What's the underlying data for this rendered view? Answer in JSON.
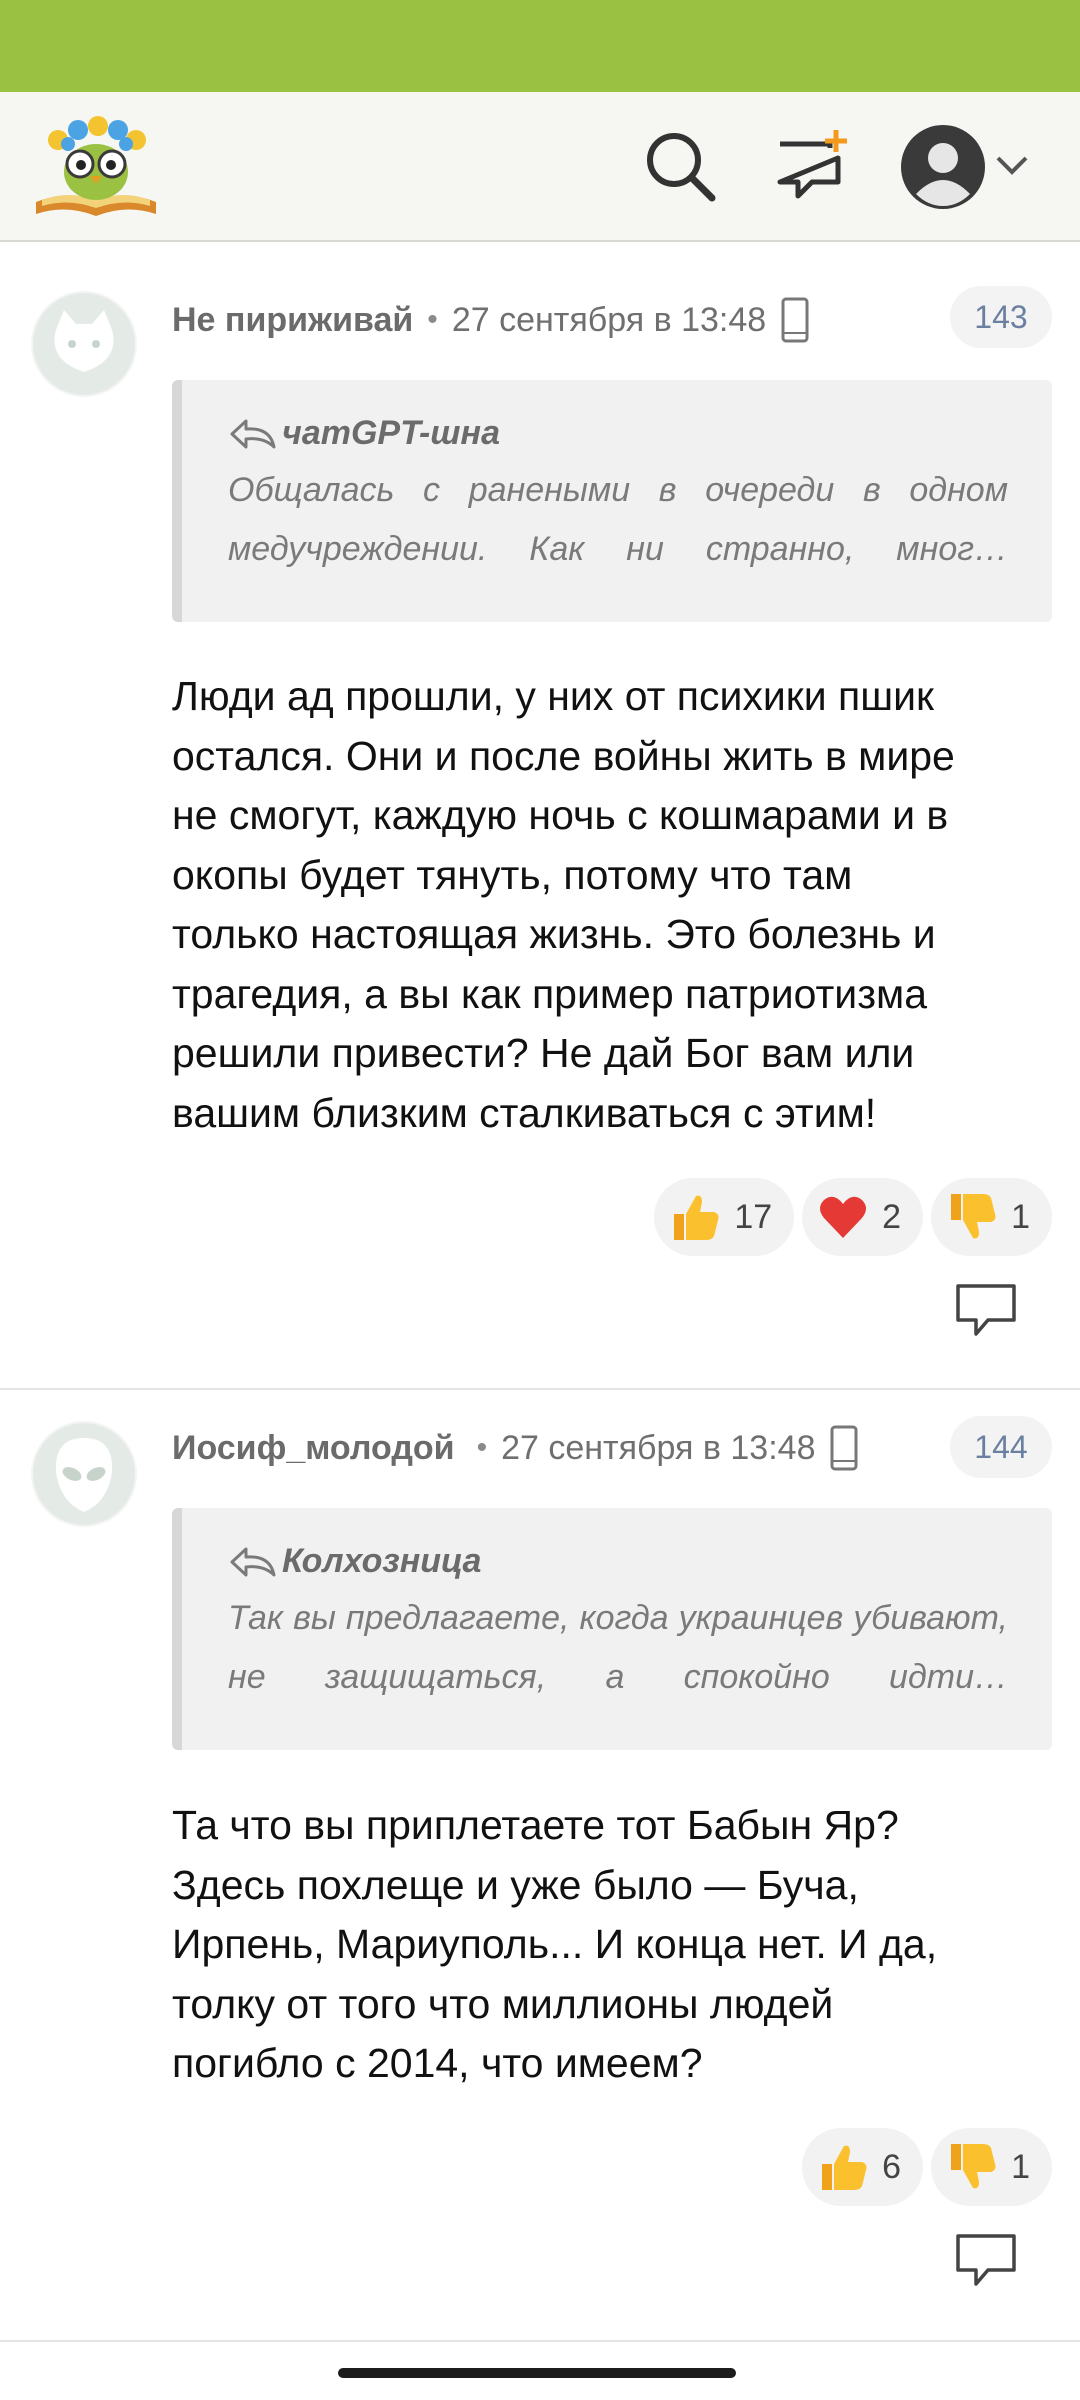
{
  "header": {
    "logo": "owl-logo",
    "icons": [
      "search-icon",
      "new-message-icon",
      "user-avatar-icon",
      "chevron-down-icon"
    ]
  },
  "comments": [
    {
      "author": "Не пириживай",
      "time": "27 сентября в 13:48",
      "number": "143",
      "avatar": "cat-avatar-icon",
      "quote_author": "чатGPT-шна",
      "quote_text": "Общалась с ранеными в очереди в одном медучреждении. Как ни странно, мног…",
      "body": [
        "Люди ад прошли, у них от психики пшик",
        "остался. Они и после войны жить в мире",
        "не смогут, каждую ночь с кошмарами и в",
        "окопы будет тянуть, потому что там",
        "только настоящая жизнь. Это болезнь и",
        "трагедия, а вы как пример патриотизма",
        "решили привести? Не дай Бог вам или",
        "вашим близким сталкиваться с этим!"
      ],
      "reactions": [
        {
          "icon": "thumbs-up-icon",
          "count": "17"
        },
        {
          "icon": "heart-icon",
          "count": "2"
        },
        {
          "icon": "thumbs-down-icon",
          "count": "1"
        }
      ]
    },
    {
      "author": "Иосиф_молодой",
      "time": "27 сентября в 13:48",
      "number": "144",
      "avatar": "alien-avatar-icon",
      "quote_author": "Колхозница",
      "quote_text": "Так вы предлагаете, когда украинцев убивают, не защищаться, а спокойно идти…",
      "body": [
        "Та что вы приплетаете тот Бабын Яр?",
        "Здесь похлеще и уже было — Буча,",
        "Ирпень, Мариуполь... И конца нет. И да,",
        "толку от того что миллионы людей",
        "погибло с 2014, что имеем?"
      ],
      "reactions": [
        {
          "icon": "thumbs-up-icon",
          "count": "6"
        },
        {
          "icon": "thumbs-down-icon",
          "count": "1"
        }
      ]
    }
  ]
}
